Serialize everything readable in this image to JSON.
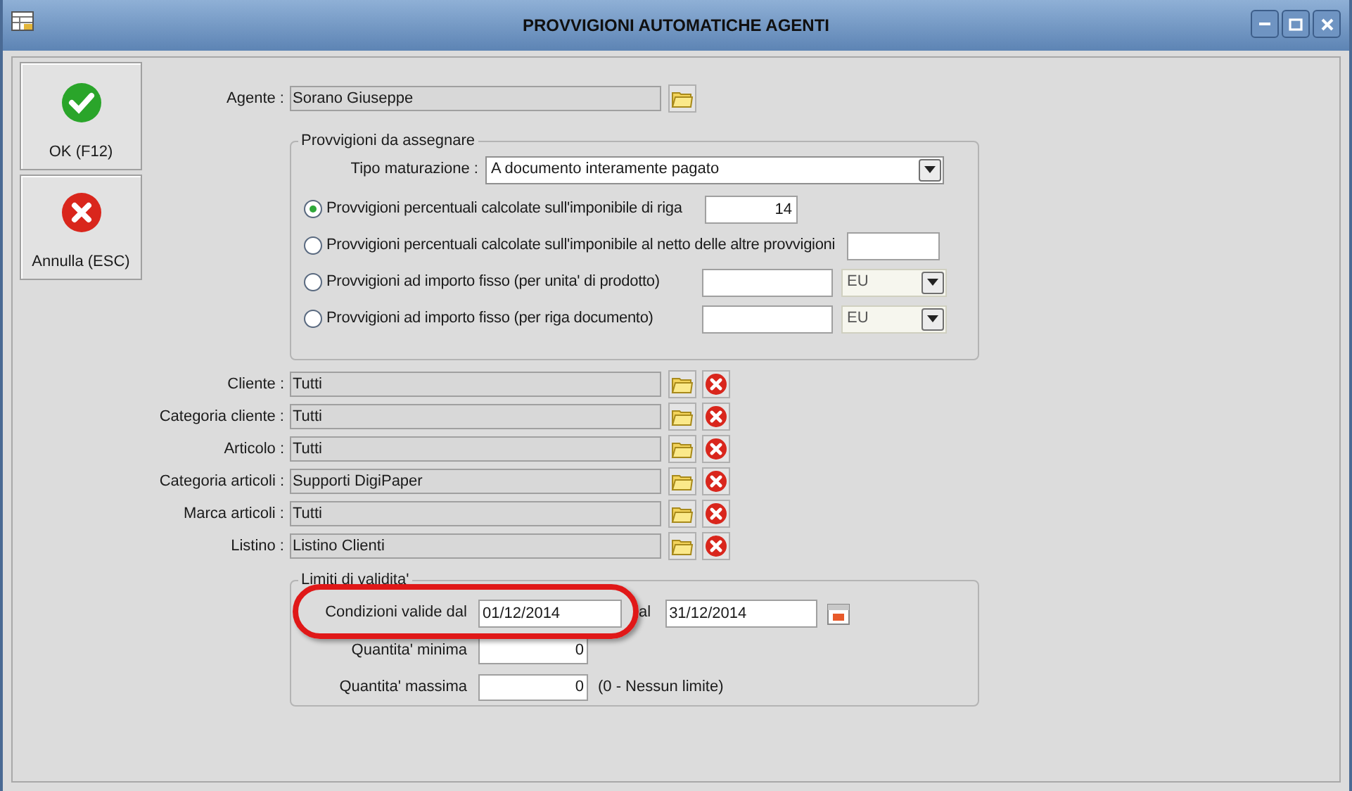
{
  "window": {
    "title": "PROVVIGIONI AUTOMATICHE AGENTI"
  },
  "buttons": [
    {
      "label": "OK (F12)",
      "kind": "ok"
    },
    {
      "label": "Annulla (ESC)",
      "kind": "cancel"
    }
  ],
  "agente": {
    "label": "Agente :",
    "value": "Sorano Giuseppe"
  },
  "provvigioni": {
    "title": "Provvigioni da assegnare",
    "tipo_maturazione": {
      "label": "Tipo maturazione :",
      "value": "A documento interamente pagato"
    },
    "options": [
      {
        "label": "Provvigioni percentuali calcolate sull'imponibile di riga",
        "selected": true,
        "kind": "input",
        "value": "14"
      },
      {
        "label": "Provvigioni percentuali calcolate sull'imponibile al netto delle altre provvigioni",
        "selected": false,
        "kind": "input"
      },
      {
        "label": "Provvigioni ad importo fisso (per unita' di prodotto)",
        "selected": false,
        "kind": "input_unit",
        "unit": "EU"
      },
      {
        "label": "Provvigioni ad importo fisso (per riga documento)",
        "selected": false,
        "kind": "input_unit",
        "unit": "EU"
      }
    ]
  },
  "filters": [
    {
      "label": "Cliente :",
      "value": "Tutti"
    },
    {
      "label": "Categoria cliente :",
      "value": "Tutti"
    },
    {
      "label": "Articolo :",
      "value": "Tutti"
    },
    {
      "label": "Categoria articoli :",
      "value": "Supporti DigiPaper"
    },
    {
      "label": "Marca articoli :",
      "value": "Tutti"
    },
    {
      "label": "Listino :",
      "value": "Listino Clienti"
    }
  ],
  "validita": {
    "title": "Limiti di validita'",
    "dal": {
      "label": "Condizioni valide dal",
      "value": "01/12/2014"
    },
    "al": {
      "label": "al",
      "value": "31/12/2014"
    },
    "minima": {
      "label": "Quantita' minima",
      "value": "0"
    },
    "massima": {
      "label": "Quantita' massima",
      "value": "0",
      "note": "(0 - Nessun limite)"
    }
  }
}
